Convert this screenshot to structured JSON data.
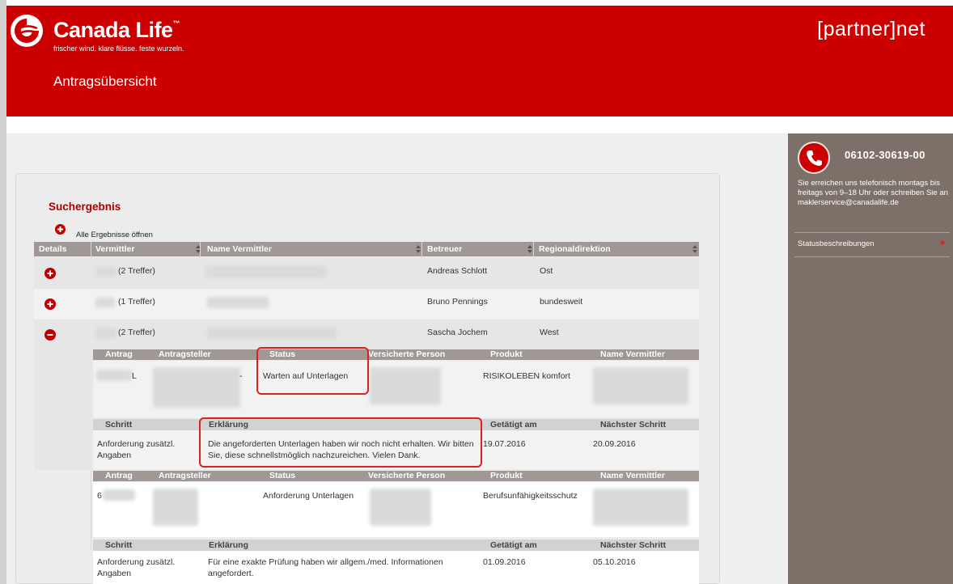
{
  "colors": {
    "brand_red": "#cc0000",
    "sidebar_bg": "#7d7068",
    "header_gray": "#a09894",
    "highlight": "#e02020"
  },
  "header": {
    "brand_name": "Canada Life",
    "brand_tm": "™",
    "tagline": "frischer wind. klare flüsse. feste wurzeln.",
    "portal": "[partner]net",
    "page_title": "Antragsübersicht"
  },
  "sidebar": {
    "phone": "06102-30619-00",
    "contact_text": "Sie erreichen uns telefonisch montags bis freitags von 9–18 Uhr oder schreiben Sie an maklerservice@canadalife.de",
    "status_link": "Statusbeschreibungen",
    "icons": {
      "phone": "phone-icon",
      "arrow": "diamond-arrow-icon"
    }
  },
  "results": {
    "title": "Suchergebnis",
    "expand_all": "Alle Ergebnisse öffnen",
    "columns": {
      "details": "Details",
      "vermittler": "Vermittler",
      "name_vermittler": "Name Vermittler",
      "betreuer": "Betreuer",
      "regionaldirektion": "Regionaldirektion"
    },
    "rows": [
      {
        "treffer": "(2 Treffer)",
        "betreuer": "Andreas Schlott",
        "region": "Ost",
        "state": "collapsed"
      },
      {
        "treffer": "(1 Treffer)",
        "betreuer": "Bruno Pennings",
        "region": "bundesweit",
        "state": "collapsed"
      },
      {
        "treffer": "(2 Treffer)",
        "betreuer": "Sascha Jochem",
        "region": "West",
        "state": "expanded"
      }
    ],
    "sub_columns": {
      "antrag": "Antrag",
      "antragsteller": "Antragsteller",
      "status": "Status",
      "versicherte_person": "Versicherte Person",
      "produkt": "Produkt",
      "name_vermittler": "Name Vermittler"
    },
    "step_columns": {
      "schritt": "Schritt",
      "erklaerung": "Erklärung",
      "getaetigt_am": "Getätigt am",
      "naechster_schritt": "Nächster Schritt"
    },
    "antraege": [
      {
        "antrag_suffix": "L",
        "antragsteller_suffix": "-",
        "status": "Warten auf Unterlagen",
        "produkt": "RISIKOLEBEN komfort",
        "schritt": "Anforderung zusätzl. Angaben",
        "erklaerung": "Die angeforderten Unterlagen haben wir noch nicht erhalten. Wir bitten Sie, diese schnellstmöglich nachzureichen. Vielen Dank.",
        "getaetigt_am": "19.07.2016",
        "naechster_schritt": "20.09.2016"
      },
      {
        "antrag_prefix": "6",
        "status": "Anforderung Unterlagen",
        "produkt": "Berufsunfähigkeitsschutz",
        "schritt": "Anforderung zusätzl. Angaben",
        "erklaerung": "Für eine exakte Prüfung haben wir allgem./med. Informationen angefordert.",
        "getaetigt_am": "01.09.2016",
        "naechster_schritt": "05.10.2016"
      }
    ]
  }
}
